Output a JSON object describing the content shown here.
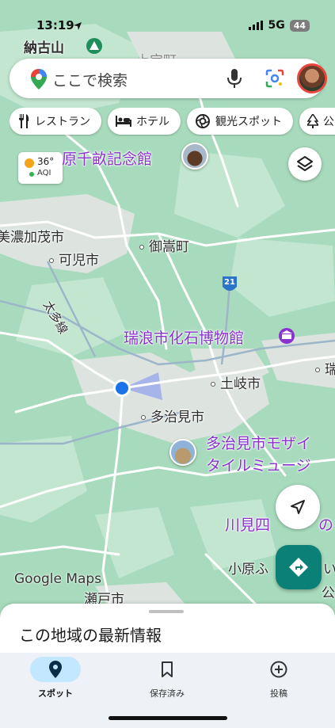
{
  "status_bar": {
    "time": "13:19",
    "network": "5G",
    "battery": "44"
  },
  "search": {
    "placeholder": "ここで検索"
  },
  "chips": [
    {
      "label": "レストラン",
      "icon": "fork-knife-icon"
    },
    {
      "label": "ホテル",
      "icon": "bed-icon"
    },
    {
      "label": "観光スポット",
      "icon": "camera-icon"
    },
    {
      "label": "公園",
      "icon": "tree-icon"
    }
  ],
  "weather": {
    "temperature": "36°",
    "aqi_label": "AQI",
    "aqi_color": "#2fb54b"
  },
  "map": {
    "labels": {
      "nakoyama": "納古山",
      "museum_north": "原千畝記念館",
      "minokamo": "美濃加茂市",
      "kani": "可児市",
      "mitake": "御嵩町",
      "taita_line": "太多線",
      "route_number": "21",
      "kaseki_museum": "瑞浪市化石博物館",
      "toki": "土岐市",
      "mizunami_short": "瑞",
      "tajimi": "多治見市",
      "mosaic_museum_line1": "多治見市モザイ",
      "mosaic_museum_line2": "タイルミュージ",
      "kawami": "川見四",
      "kawami2": "の",
      "ohara": "小原ふ",
      "ohara2": "い",
      "park": "公園",
      "seto": "瀬戸市",
      "town_top": "上宝町"
    },
    "brand": "Google Maps",
    "colors": {
      "land": "#a8dbbd",
      "urban": "#dfe6e3",
      "road": "#ffffff",
      "highway": "#8fa9bf",
      "poi": "#8a33cc"
    }
  },
  "sheet": {
    "title": "この地域の最新情報"
  },
  "nav": [
    {
      "label": "スポット",
      "icon": "location-pin-icon",
      "active": true
    },
    {
      "label": "保存済み",
      "icon": "bookmark-icon",
      "active": false
    },
    {
      "label": "投稿",
      "icon": "add-circle-icon",
      "active": false
    }
  ]
}
